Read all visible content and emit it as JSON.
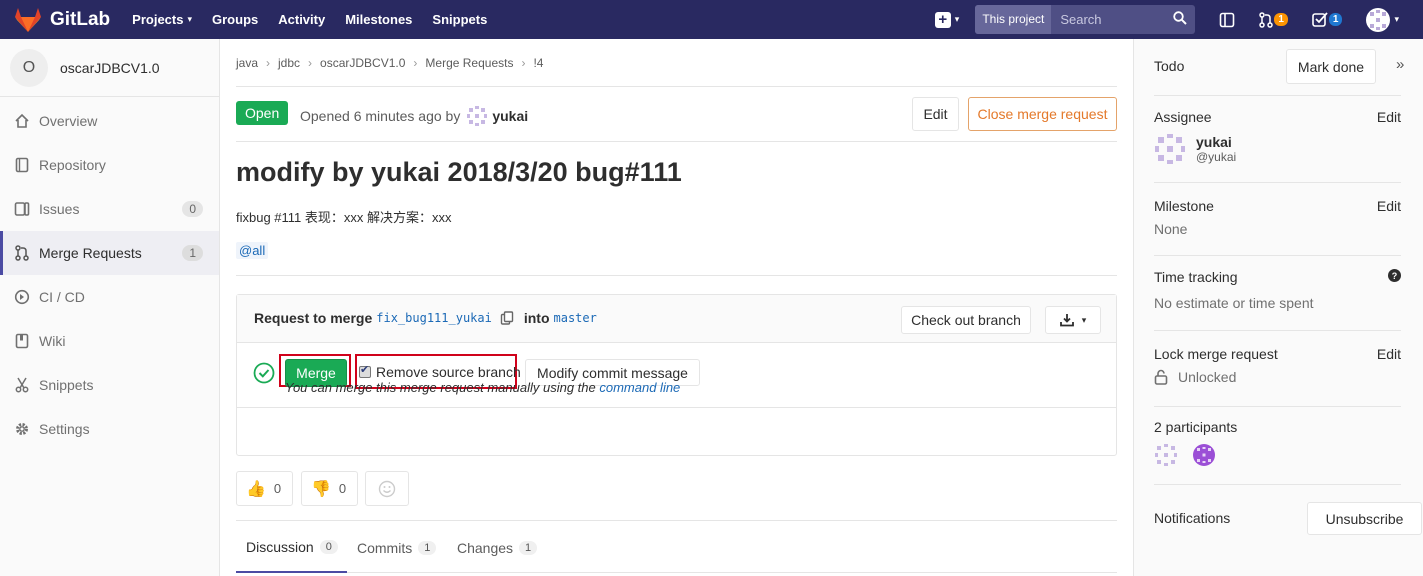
{
  "navbar": {
    "brand": "GitLab",
    "links": [
      {
        "label": "Projects",
        "caret": true
      },
      {
        "label": "Groups"
      },
      {
        "label": "Activity"
      },
      {
        "label": "Milestones"
      },
      {
        "label": "Snippets"
      }
    ],
    "search_scope": "This project",
    "search_placeholder": "Search",
    "mr_count": "1",
    "todo_count": "1",
    "colors": {
      "bg": "#292961",
      "mr_badge": "#fc9403",
      "todo_badge": "#1f78d1"
    }
  },
  "sidebar": {
    "project_initial": "O",
    "project_name": "oscarJDBCV1.0",
    "items": [
      {
        "label": "Overview",
        "icon": "home-icon"
      },
      {
        "label": "Repository",
        "icon": "book-icon"
      },
      {
        "label": "Issues",
        "icon": "issues-icon",
        "count": "0"
      },
      {
        "label": "Merge Requests",
        "icon": "merge-request-icon",
        "count": "1",
        "active": true
      },
      {
        "label": "CI / CD",
        "icon": "rocket-icon"
      },
      {
        "label": "Wiki",
        "icon": "wiki-book-icon"
      },
      {
        "label": "Snippets",
        "icon": "scissors-icon"
      },
      {
        "label": "Settings",
        "icon": "gear-icon"
      }
    ]
  },
  "breadcrumb": [
    "java",
    "jdbc",
    "oscarJDBCV1.0",
    "Merge Requests",
    "!4"
  ],
  "mr": {
    "status": "Open",
    "opened_text": "Opened 6 minutes ago by",
    "author": "yukai",
    "edit_label": "Edit",
    "close_label": "Close merge request",
    "title": "modify by yukai 2018/3/20 bug#111",
    "description": "fixbug #111 表现：xxx 解决方案：xxx",
    "mention": "@all",
    "request_prefix": "Request to merge",
    "source_branch": "fix_bug111_yukai",
    "into_label": "into",
    "target_branch": "master",
    "checkout_label": "Check out branch",
    "merge_label": "Merge",
    "remove_source_label": "Remove source branch",
    "remove_source_checked": true,
    "modify_commit_label": "Modify commit message",
    "manual_text": "You can merge this merge request manually using the",
    "command_line_link": "command line"
  },
  "awards": {
    "thumbs_up": "0",
    "thumbs_down": "0"
  },
  "tabs": [
    {
      "label": "Discussion",
      "count": "0",
      "active": true
    },
    {
      "label": "Commits",
      "count": "1"
    },
    {
      "label": "Changes",
      "count": "1"
    }
  ],
  "right_sidebar": {
    "todo_label": "Todo",
    "mark_done_label": "Mark done",
    "assignee_label": "Assignee",
    "edit_label": "Edit",
    "assignee_name": "yukai",
    "assignee_handle": "@yukai",
    "milestone_label": "Milestone",
    "milestone_value": "None",
    "time_tracking_label": "Time tracking",
    "time_tracking_value": "No estimate or time spent",
    "lock_label": "Lock merge request",
    "lock_value": "Unlocked",
    "participants_label": "2 participants",
    "notifications_label": "Notifications",
    "unsubscribe_label": "Unsubscribe"
  }
}
